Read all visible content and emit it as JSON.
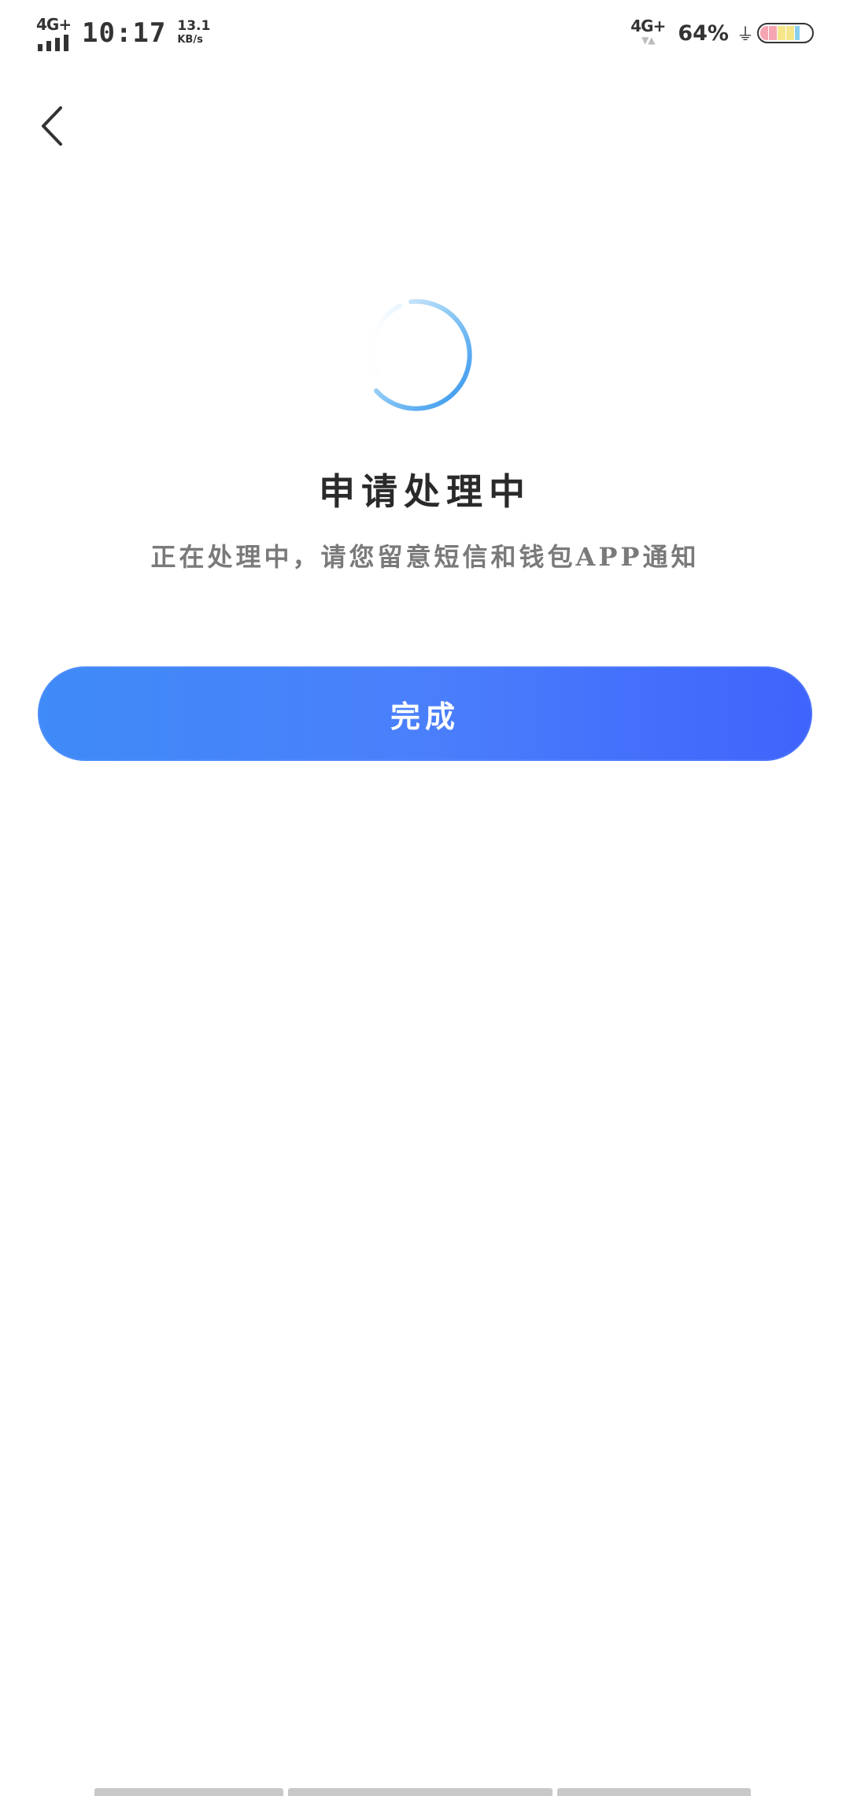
{
  "status_bar": {
    "network_left": "4G+",
    "time": "10:17",
    "speed_value": "13.1",
    "speed_unit": "KB/s",
    "network_right": "4G+",
    "battery_percent": "64%"
  },
  "page": {
    "title": "申请处理中",
    "subtitle": "正在处理中，请您留意短信和钱包APP通知",
    "done_label": "完成"
  },
  "colors": {
    "accent_start": "#3f8bf8",
    "accent_end": "#3f63fb",
    "spinner": "#3b9af0"
  },
  "icons": {
    "back": "chevron-left-icon",
    "spinner": "loading-spinner-icon"
  }
}
